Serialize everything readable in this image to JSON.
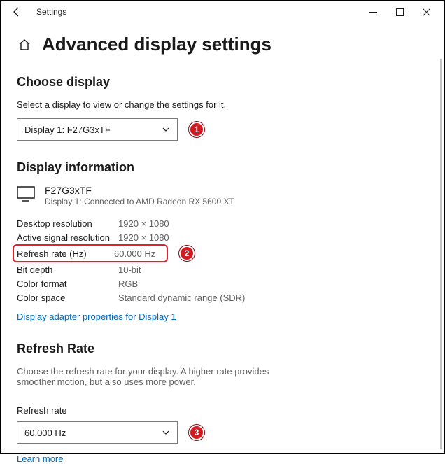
{
  "titlebar": {
    "title": "Settings"
  },
  "page": {
    "title": "Advanced display settings"
  },
  "choose": {
    "heading": "Choose display",
    "desc": "Select a display to view or change the settings for it.",
    "selected": "Display 1: F27G3xTF"
  },
  "info": {
    "heading": "Display information",
    "monitor_name": "F27G3xTF",
    "monitor_sub": "Display 1: Connected to AMD Radeon RX 5600 XT",
    "rows": {
      "desktop_res_k": "Desktop resolution",
      "desktop_res_v": "1920 × 1080",
      "active_res_k": "Active signal resolution",
      "active_res_v": "1920 × 1080",
      "refresh_k": "Refresh rate (Hz)",
      "refresh_v": "60.000 Hz",
      "bitdepth_k": "Bit depth",
      "bitdepth_v": "10-bit",
      "colorfmt_k": "Color format",
      "colorfmt_v": "RGB",
      "colorspc_k": "Color space",
      "colorspc_v": "Standard dynamic range (SDR)"
    },
    "adapter_link": "Display adapter properties for Display 1"
  },
  "refresh": {
    "heading": "Refresh Rate",
    "desc": "Choose the refresh rate for your display. A higher rate provides smoother motion, but also uses more power.",
    "label": "Refresh rate",
    "selected": "60.000 Hz",
    "learn_more": "Learn more"
  },
  "badges": {
    "b1": "1",
    "b2": "2",
    "b3": "3"
  }
}
